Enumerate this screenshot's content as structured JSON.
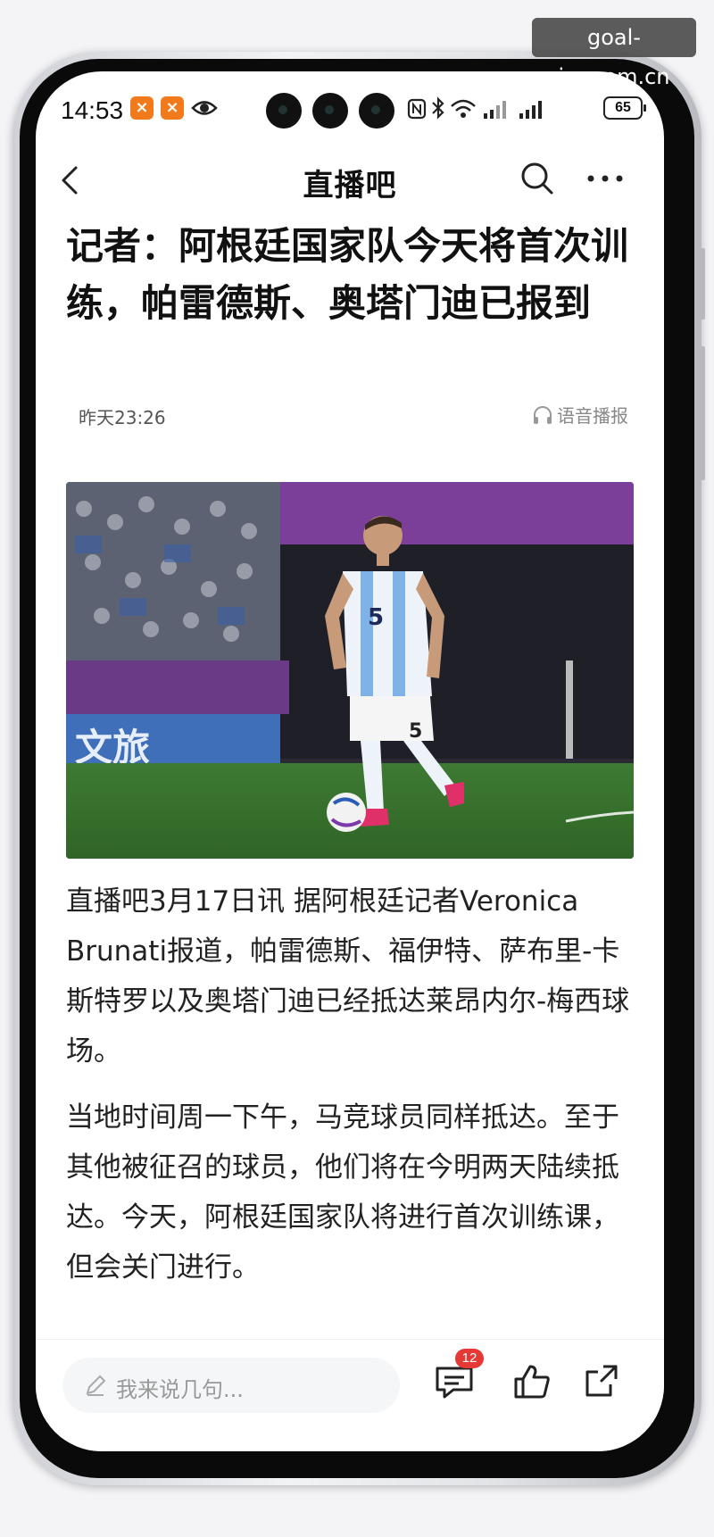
{
  "watermark": "goal-im.com.cn",
  "status_bar": {
    "time": "14:53",
    "battery": "65"
  },
  "nav": {
    "title": "直播吧"
  },
  "article": {
    "headline": "记者：阿根廷国家队今天将首次训练，帕雷德斯、奥塔门迪已报到",
    "time": "昨天23:26",
    "audio_label": "语音播报",
    "paragraphs": [
      "直播吧3月17日讯 据阿根廷记者Veronica Brunati报道，帕雷德斯、福伊特、萨布里-卡斯特罗以及奥塔门迪已经抵达莱昂内尔-梅西球场。",
      "当地时间周一下午，马竞球员同样抵达。至于其他被征召的球员，他们将在今明两天陆续抵达。今天，阿根廷国家队将进行首次训练课，但会关门进行。"
    ],
    "photo": {
      "jersey_number": "5",
      "board_text": "文旅"
    }
  },
  "bottom_bar": {
    "comment_placeholder": "我来说几句...",
    "comment_count": "12"
  }
}
